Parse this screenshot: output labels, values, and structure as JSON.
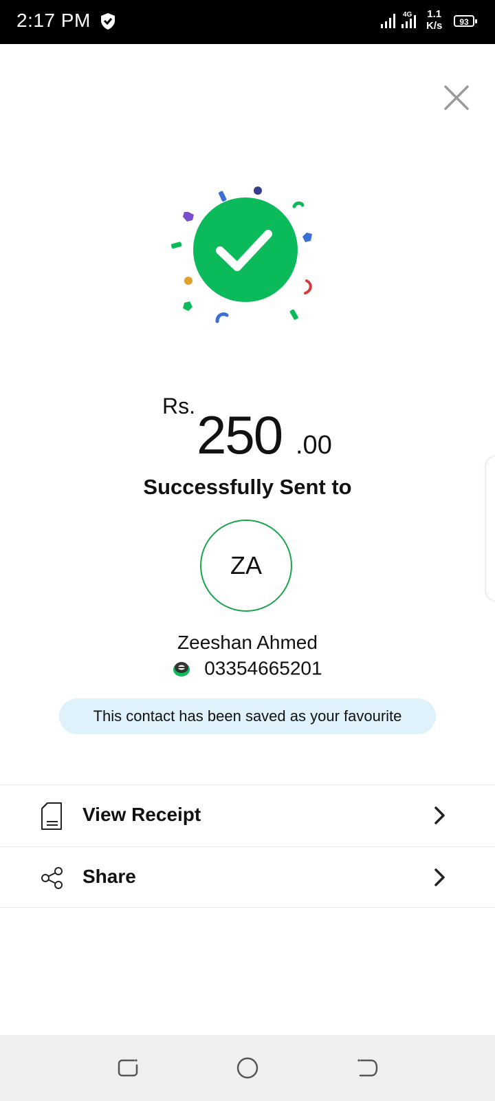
{
  "status_bar": {
    "time": "2:17 PM",
    "network_type": "4G",
    "net_speed_value": "1.1",
    "net_speed_unit": "K/s",
    "battery": "93",
    "icons": [
      "shield-icon",
      "signal-icon",
      "signal-4g-icon",
      "battery-icon"
    ]
  },
  "close_icon": "close-icon",
  "transaction": {
    "currency": "Rs.",
    "amount_main": "250",
    "amount_decimal": ".00",
    "status_text": "Successfully Sent to"
  },
  "recipient": {
    "initials": "ZA",
    "name": "Zeeshan Ahmed",
    "phone": "03354665201",
    "wallet_icon": "easypaisa-icon"
  },
  "favourite_banner": "This contact has been saved as your favourite",
  "actions": [
    {
      "label": "View Receipt",
      "icon": "receipt-icon"
    },
    {
      "label": "Share",
      "icon": "share-icon"
    }
  ],
  "colors": {
    "success_green": "#0bba5a",
    "avatar_border": "#19a54a",
    "banner_bg": "#dff2fc",
    "status_bar_bg": "#000000",
    "nav_bar_bg": "#efefef"
  }
}
